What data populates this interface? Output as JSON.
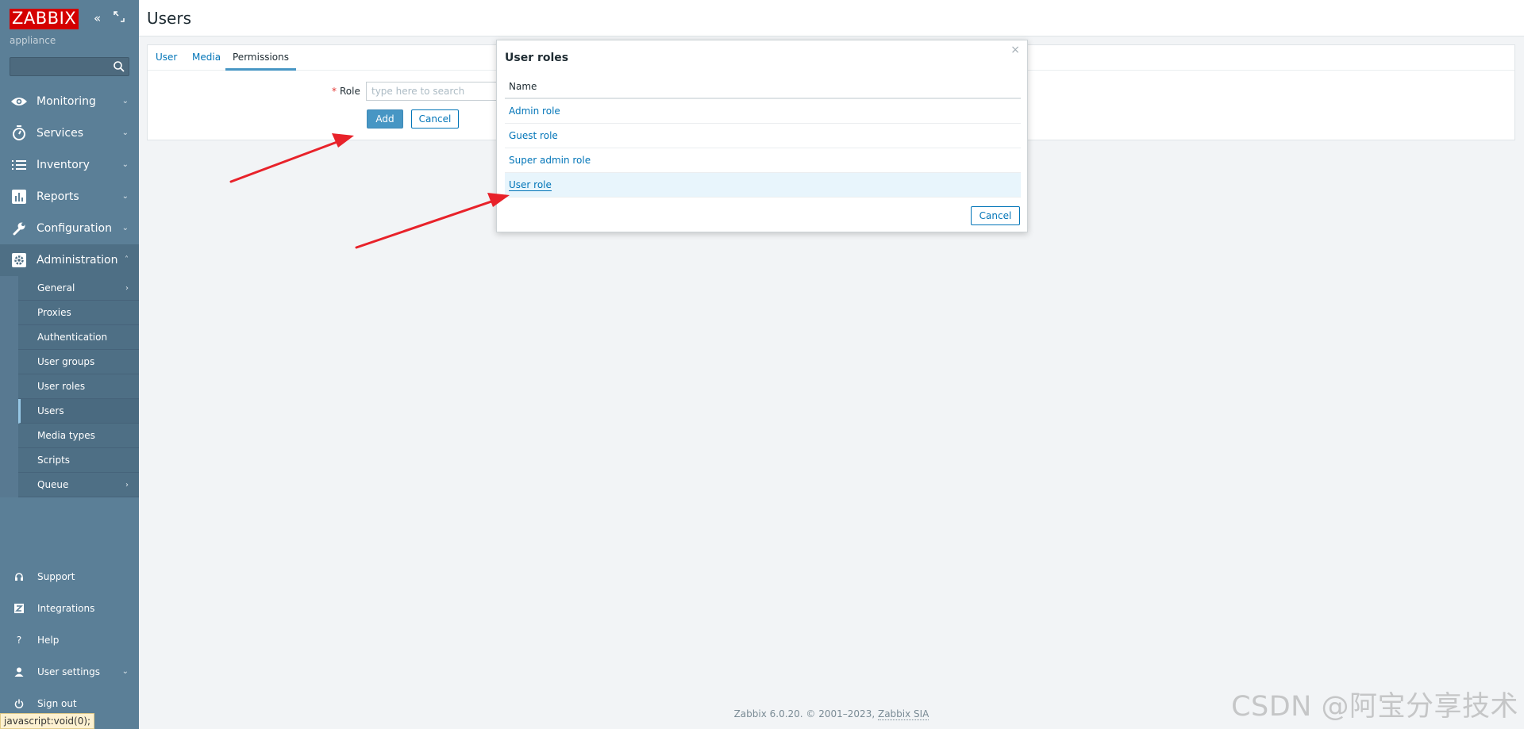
{
  "sidebar": {
    "logo_text": "ZABBIX",
    "subtitle": "appliance",
    "search_placeholder": "",
    "menu": [
      {
        "label": "Monitoring",
        "icon": "eye-icon"
      },
      {
        "label": "Services",
        "icon": "stopwatch-icon"
      },
      {
        "label": "Inventory",
        "icon": "list-icon"
      },
      {
        "label": "Reports",
        "icon": "bar-chart-icon"
      },
      {
        "label": "Configuration",
        "icon": "wrench-icon"
      },
      {
        "label": "Administration",
        "icon": "gear-icon"
      }
    ],
    "submenu": [
      "General",
      "Proxies",
      "Authentication",
      "User groups",
      "User roles",
      "Users",
      "Media types",
      "Scripts",
      "Queue"
    ],
    "bottom": [
      {
        "label": "Support",
        "icon": "headset-icon"
      },
      {
        "label": "Integrations",
        "icon": "z-icon"
      },
      {
        "label": "Help",
        "icon": "question-icon"
      },
      {
        "label": "User settings",
        "icon": "user-icon"
      },
      {
        "label": "Sign out",
        "icon": "power-icon"
      }
    ]
  },
  "status_bar": "javascript:void(0);",
  "page": {
    "title": "Users"
  },
  "tabs": [
    "User",
    "Media",
    "Permissions"
  ],
  "form": {
    "required_mark": "*",
    "role_label": "Role",
    "role_placeholder": "type here to search",
    "add_label": "Add",
    "cancel_label": "Cancel"
  },
  "dialog": {
    "title": "User roles",
    "close": "×",
    "column_header": "Name",
    "rows": [
      "Admin role",
      "Guest role",
      "Super admin role",
      "User role"
    ],
    "cancel_label": "Cancel"
  },
  "footer": {
    "text": "Zabbix 6.0.20. © 2001–2023, ",
    "company": "Zabbix SIA"
  },
  "watermark": "CSDN @阿宝分享技术",
  "colors": {
    "sidebar": "#5b7f97",
    "logo": "#d40000",
    "link": "#0275b8",
    "primary_button": "#4796c4",
    "annotation_arrow": "#e8222a"
  }
}
